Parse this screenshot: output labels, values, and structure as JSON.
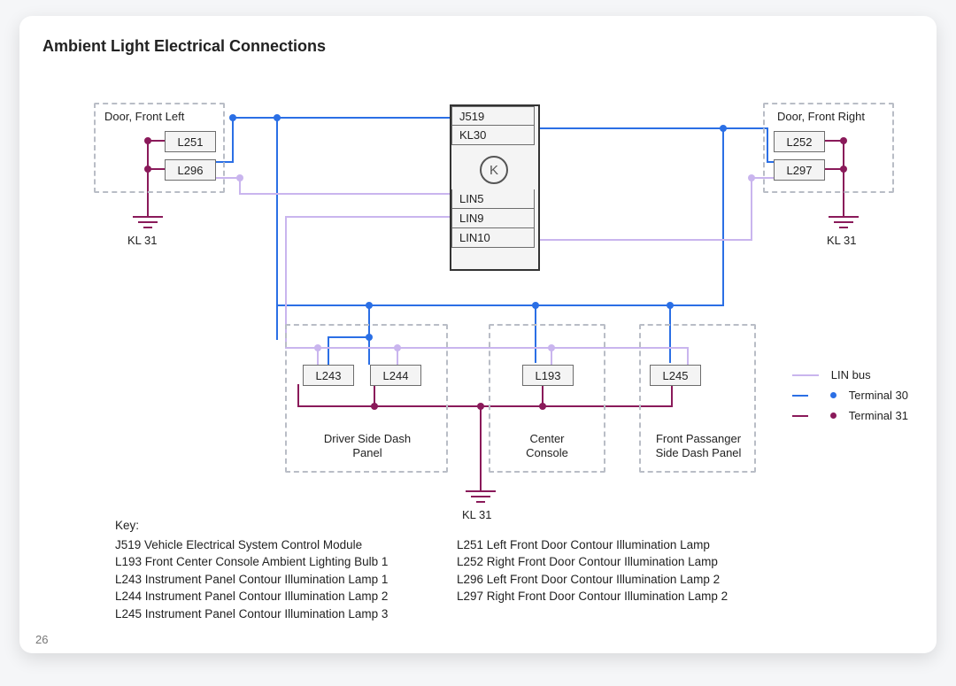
{
  "title": "Ambient Light Electrical Connections",
  "page_number": "26",
  "module": {
    "id": "J519",
    "rows": [
      "KL30",
      "LIN5",
      "LIN9",
      "LIN10"
    ],
    "glyph": "K"
  },
  "enclosures": {
    "door_front_left": "Door, Front Left",
    "door_front_right": "Door, Front Right",
    "driver_dash": "Driver Side Dash\nPanel",
    "center_console": "Center\nConsole",
    "front_pass_dash": "Front Passanger\nSide Dash Panel"
  },
  "lamps": {
    "L251": "L251",
    "L296": "L296",
    "L252": "L252",
    "L297": "L297",
    "L243": "L243",
    "L244": "L244",
    "L193": "L193",
    "L245": "L245"
  },
  "ground_label": "KL 31",
  "legend": [
    {
      "label": "LIN bus",
      "role": "lin"
    },
    {
      "label": "Terminal 30",
      "role": "t30"
    },
    {
      "label": "Terminal 31",
      "role": "t31"
    }
  ],
  "key": {
    "heading": "Key:",
    "left": [
      "J519 Vehicle Electrical System Control Module",
      "L193 Front Center Console Ambient Lighting Bulb 1",
      "L243 Instrument Panel Contour Illumination Lamp 1",
      "L244 Instrument Panel Contour Illumination Lamp 2",
      "L245 Instrument Panel Contour Illumination Lamp 3"
    ],
    "right": [
      "L251 Left Front Door Contour Illumination Lamp",
      "L252 Right Front Door Contour Illumination Lamp",
      "L296 Left Front Door Contour Illumination Lamp 2",
      "L297 Right Front Door Contour Illumination Lamp 2"
    ]
  }
}
